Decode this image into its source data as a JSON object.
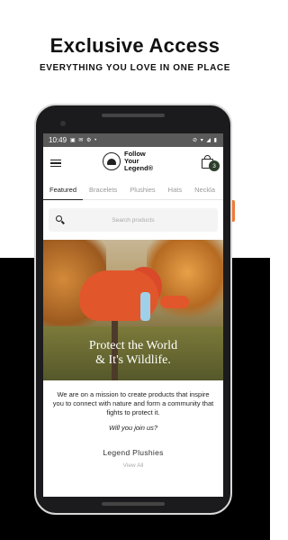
{
  "promo": {
    "headline": "Exclusive Access",
    "subheadline": "EVERYTHING YOU LOVE IN ONE PLACE"
  },
  "status_bar": {
    "time": "10:49",
    "left_icons": "▣ ✉ ⚙ •",
    "right_icons": "⊘ ▾ ◢ ▮"
  },
  "app": {
    "brand_line1": "Follow",
    "brand_line2": "Your",
    "brand_line3": "Legend",
    "brand_mark": "®",
    "cart_count": "3"
  },
  "tabs": [
    "Featured",
    "Bracelets",
    "Plushies",
    "Hats",
    "Neckla"
  ],
  "search": {
    "placeholder": "Search products"
  },
  "hero": {
    "line1": "Protect the World",
    "line2": "& It's Wildlife."
  },
  "mission": {
    "text": "We are on a mission to create products that inspire you to connect with nature and form a community that fights to protect it.",
    "question": "Will you join us?"
  },
  "section": {
    "title": "Legend Plushies",
    "link": "View All"
  }
}
